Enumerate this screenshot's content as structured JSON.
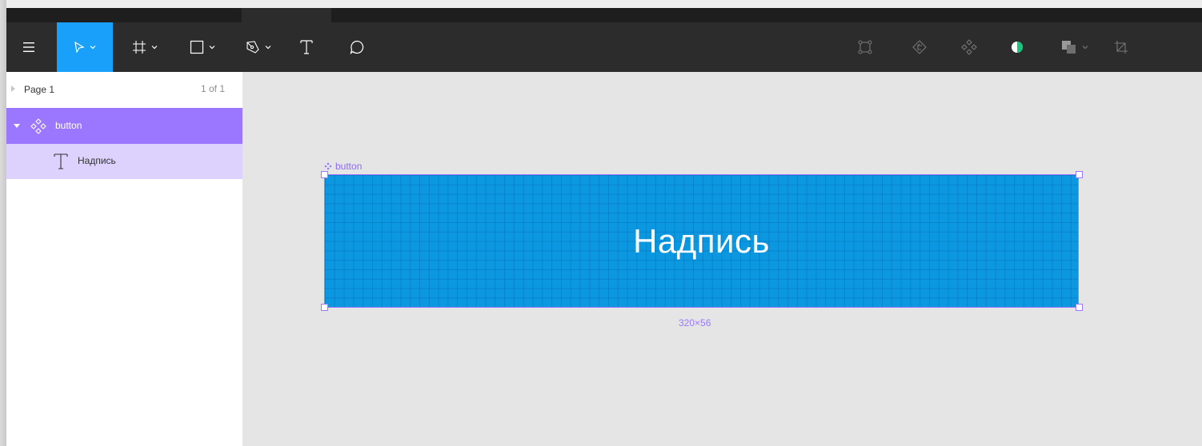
{
  "toolbar": {
    "left_tools": [
      {
        "name": "menu-icon"
      },
      {
        "name": "move-tool-icon",
        "active": true
      },
      {
        "name": "frame-tool-icon"
      },
      {
        "name": "rectangle-tool-icon"
      },
      {
        "name": "pen-tool-icon"
      },
      {
        "name": "text-tool-icon"
      },
      {
        "name": "comment-tool-icon"
      }
    ],
    "right_tools": [
      {
        "name": "outline-icon"
      },
      {
        "name": "use-as-mask-icon"
      },
      {
        "name": "create-component-icon"
      },
      {
        "name": "contrast-toggle-icon"
      },
      {
        "name": "boolean-group-icon"
      },
      {
        "name": "crop-icon"
      }
    ],
    "accent": "#18a0fb"
  },
  "sidebar": {
    "page": {
      "label": "Page 1",
      "count": "1 of 1"
    },
    "layers": [
      {
        "label": "button",
        "type": "component",
        "selected": true
      },
      {
        "label": "Надпись",
        "type": "text"
      }
    ],
    "selection_color": "#9b77ff"
  },
  "canvas": {
    "frame_label": "button",
    "button_text": "Надпись",
    "size_label": "320×56",
    "frame_color": "#0b98e1"
  }
}
